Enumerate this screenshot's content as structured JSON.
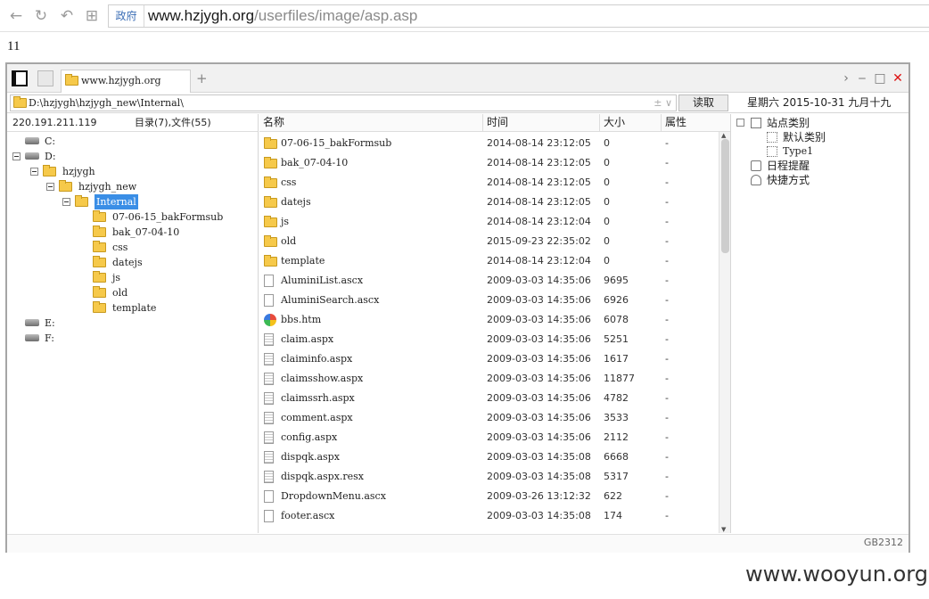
{
  "browser": {
    "address_tag": "政府",
    "url_host": "www.hzjygh.org",
    "url_path": "/userfiles/image/asp.asp",
    "icons": [
      "back-icon",
      "refresh-icon",
      "undo-icon",
      "apps-icon"
    ]
  },
  "page_number": "11",
  "shell": {
    "tab_label": "www.hzjygh.org",
    "tab_add": "+",
    "path": "D:\\hzjygh\\hzjygh_new\\Internal\\",
    "path_extra": "±  ∨",
    "read_button": "读取",
    "date_text": "星期六  2015-10-31  九月十九",
    "server_ip": "220.191.211.119",
    "counts": "目录(7),文件(55)",
    "status_encoding": "GB2312"
  },
  "tree": [
    {
      "label": "C:",
      "type": "drive"
    },
    {
      "label": "D:",
      "type": "drive",
      "open": true
    },
    {
      "label": "hzjygh",
      "type": "folder",
      "open": true
    },
    {
      "label": "hzjygh_new",
      "type": "folder",
      "open": true
    },
    {
      "label": "Internal",
      "type": "folder",
      "open": true,
      "selected": true
    },
    {
      "label": "07-06-15_bakFormsub",
      "type": "folder"
    },
    {
      "label": "bak_07-04-10",
      "type": "folder"
    },
    {
      "label": "css",
      "type": "folder"
    },
    {
      "label": "datejs",
      "type": "folder"
    },
    {
      "label": "js",
      "type": "folder"
    },
    {
      "label": "old",
      "type": "folder"
    },
    {
      "label": "template",
      "type": "folder"
    },
    {
      "label": "E:",
      "type": "drive"
    },
    {
      "label": "F:",
      "type": "drive"
    }
  ],
  "columns": {
    "name": "名称",
    "time": "时间",
    "size": "大小",
    "attr": "属性"
  },
  "files": [
    {
      "name": "07-06-15_bakFormsub",
      "time": "2014-08-14 23:12:05",
      "size": "0",
      "attr": "-",
      "icon": "folder"
    },
    {
      "name": "bak_07-04-10",
      "time": "2014-08-14 23:12:05",
      "size": "0",
      "attr": "-",
      "icon": "folder"
    },
    {
      "name": "css",
      "time": "2014-08-14 23:12:05",
      "size": "0",
      "attr": "-",
      "icon": "folder"
    },
    {
      "name": "datejs",
      "time": "2014-08-14 23:12:05",
      "size": "0",
      "attr": "-",
      "icon": "folder"
    },
    {
      "name": "js",
      "time": "2014-08-14 23:12:04",
      "size": "0",
      "attr": "-",
      "icon": "folder"
    },
    {
      "name": "old",
      "time": "2015-09-23 22:35:02",
      "size": "0",
      "attr": "-",
      "icon": "folder"
    },
    {
      "name": "template",
      "time": "2014-08-14 23:12:04",
      "size": "0",
      "attr": "-",
      "icon": "folder"
    },
    {
      "name": "AluminiList.ascx",
      "time": "2009-03-03 14:35:06",
      "size": "9695",
      "attr": "-",
      "icon": "file"
    },
    {
      "name": "AluminiSearch.ascx",
      "time": "2009-03-03 14:35:06",
      "size": "6926",
      "attr": "-",
      "icon": "file"
    },
    {
      "name": "bbs.htm",
      "time": "2009-03-03 14:35:06",
      "size": "6078",
      "attr": "-",
      "icon": "globe"
    },
    {
      "name": "claim.aspx",
      "time": "2009-03-03 14:35:06",
      "size": "5251",
      "attr": "-",
      "icon": "doc"
    },
    {
      "name": "claiminfo.aspx",
      "time": "2009-03-03 14:35:06",
      "size": "1617",
      "attr": "-",
      "icon": "doc"
    },
    {
      "name": "claimsshow.aspx",
      "time": "2009-03-03 14:35:06",
      "size": "11877",
      "attr": "-",
      "icon": "doc"
    },
    {
      "name": "claimssrh.aspx",
      "time": "2009-03-03 14:35:06",
      "size": "4782",
      "attr": "-",
      "icon": "doc"
    },
    {
      "name": "comment.aspx",
      "time": "2009-03-03 14:35:06",
      "size": "3533",
      "attr": "-",
      "icon": "doc"
    },
    {
      "name": "config.aspx",
      "time": "2009-03-03 14:35:06",
      "size": "2112",
      "attr": "-",
      "icon": "doc"
    },
    {
      "name": "dispqk.aspx",
      "time": "2009-03-03 14:35:08",
      "size": "6668",
      "attr": "-",
      "icon": "doc"
    },
    {
      "name": "dispqk.aspx.resx",
      "time": "2009-03-03 14:35:08",
      "size": "5317",
      "attr": "-",
      "icon": "doc"
    },
    {
      "name": "DropdownMenu.ascx",
      "time": "2009-03-26 13:12:32",
      "size": "622",
      "attr": "-",
      "icon": "file"
    },
    {
      "name": "footer.ascx",
      "time": "2009-03-03 14:35:08",
      "size": "174",
      "attr": "-",
      "icon": "file"
    }
  ],
  "right_panel": {
    "site_category": "站点类别",
    "default_category": "默认类别",
    "type1": "Type1",
    "schedule": "日程提醒",
    "shortcuts": "快捷方式"
  },
  "watermark": "www.wooyun.org"
}
